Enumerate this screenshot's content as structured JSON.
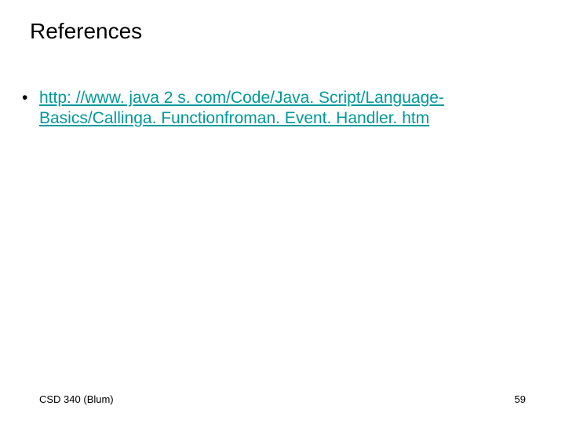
{
  "title": "References",
  "bullet": {
    "marker": "•",
    "link_line1": "http: //www. java 2 s. com/Code/Java. Script/Language-",
    "link_line2": "Basics/Callinga. Functionfroman. Event. Handler. htm"
  },
  "footer": {
    "left": "CSD 340 (Blum)",
    "right": "59"
  }
}
